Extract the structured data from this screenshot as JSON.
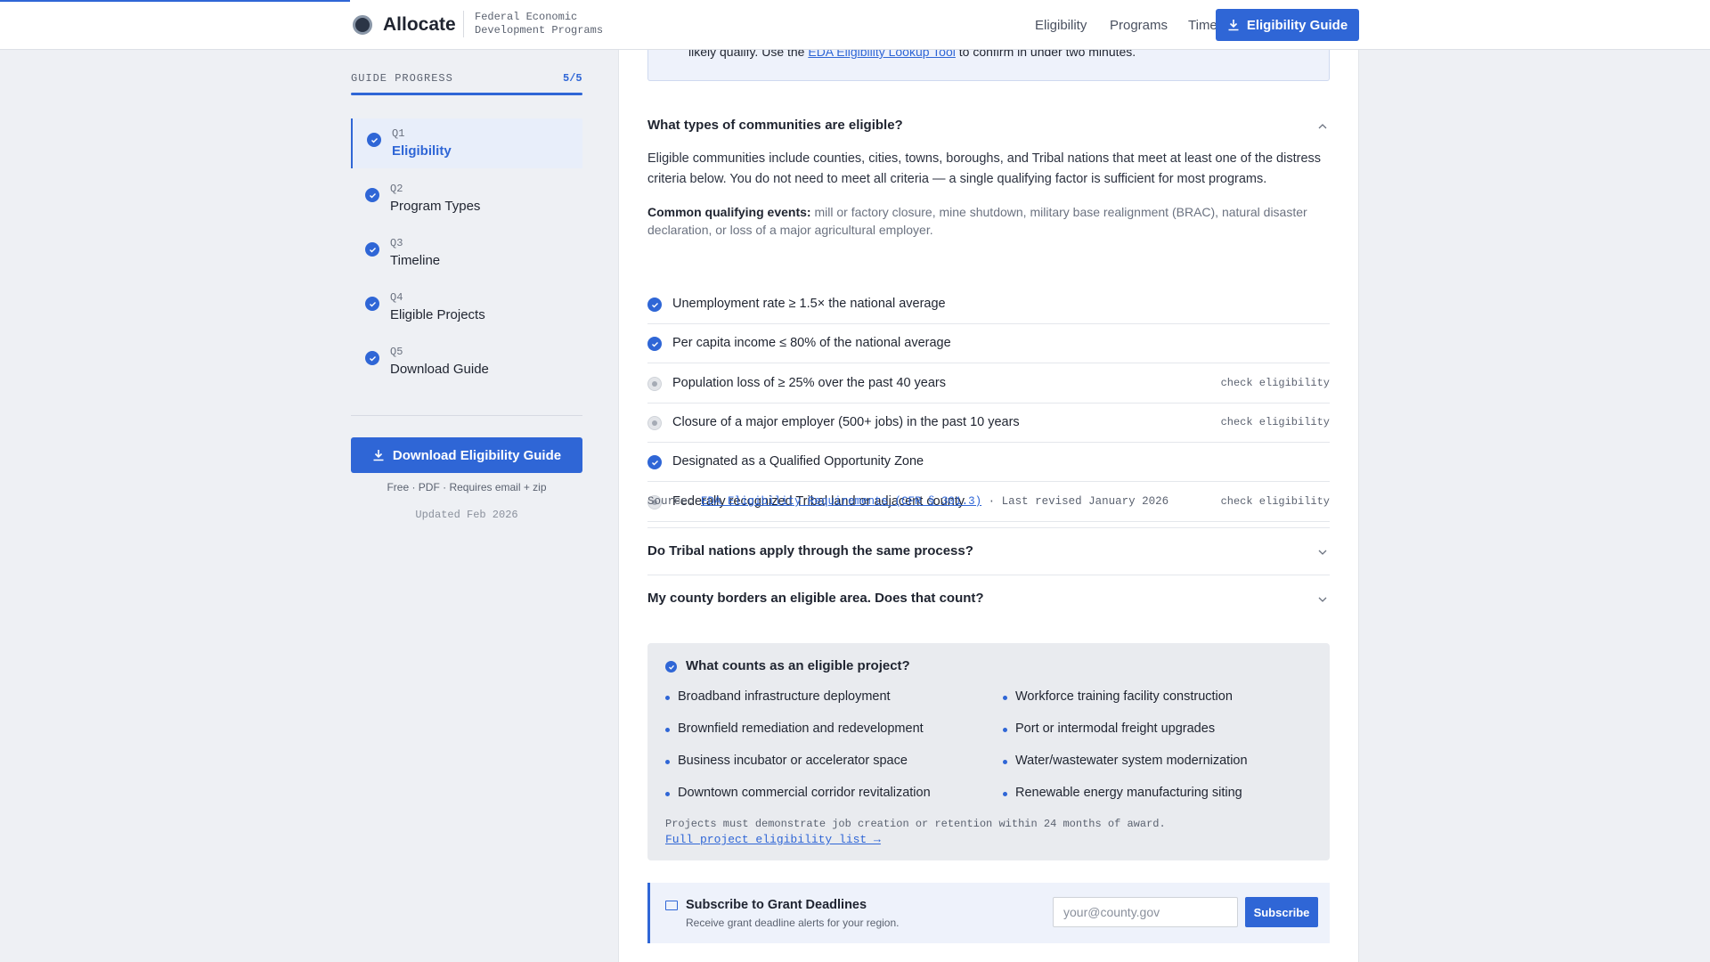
{
  "header": {
    "brand": "Allocate",
    "subtitle": "Federal Economic Development Programs",
    "nav": [
      "Eligibility",
      "Programs",
      "Timeline"
    ],
    "cta_label": "Eligibility Guide"
  },
  "sidebar": {
    "progress_label": "GUIDE PROGRESS",
    "progress_count": "5/5",
    "progress_fraction": 1.0,
    "items": [
      {
        "num": "Q1",
        "title": "Eligibility",
        "active": true
      },
      {
        "num": "Q2",
        "title": "Program Types",
        "active": false
      },
      {
        "num": "Q3",
        "title": "Timeline",
        "active": false
      },
      {
        "num": "Q4",
        "title": "Eligible Projects",
        "active": false
      },
      {
        "num": "Q5",
        "title": "Download Guide",
        "active": false
      }
    ],
    "download_label": "Download Eligibility Guide",
    "download_note": "Free · PDF · Requires email + zip",
    "updated": "Updated Feb 2026"
  },
  "callout": {
    "prefix": "likely qualify. Use the ",
    "link": "EDA Eligibility Lookup Tool",
    "suffix": " to confirm in under two minutes."
  },
  "faq": {
    "q1": "What types of communities are eligible?",
    "answer": "Eligible communities include counties, cities, towns, boroughs, and Tribal nations that meet at least one of the distress criteria below. You do not need to meet all criteria — a single qualifying factor is sufficient for most programs.",
    "events_label": "Common qualifying events:",
    "events_text": " mill or factory closure, mine shutdown, military base realignment (BRAC), natural disaster declaration, or loss of a major agricultural employer.",
    "criteria": [
      {
        "text": "Unemployment rate ≥ 1.5× the national average",
        "met": true,
        "side": ""
      },
      {
        "text": "Per capita income ≤ 80% of the national average",
        "met": true,
        "side": ""
      },
      {
        "text": "Population loss of ≥ 25% over the past 40 years",
        "met": false,
        "side": "check eligibility"
      },
      {
        "text": "Closure of a major employer (500+ jobs) in the past 10 years",
        "met": false,
        "side": "check eligibility"
      },
      {
        "text": "Designated as a Qualified Opportunity Zone",
        "met": true,
        "side": ""
      },
      {
        "text": "Federally recognized Tribal land or adjacent county",
        "met": false,
        "side": "check eligibility"
      }
    ],
    "source_prefix": "Source: ",
    "source_link": "EDA Eligibility Requirements (CFR § 301.3)",
    "source_suffix": " · Last revised January 2026",
    "q2": "Do Tribal nations apply through the same process?",
    "q3": "My county borders an eligible area. Does that count?"
  },
  "projects": {
    "title": "What counts as an eligible project?",
    "left": [
      "Broadband infrastructure deployment",
      "Brownfield remediation and redevelopment",
      "Business incubator or accelerator space",
      "Downtown commercial corridor revitalization"
    ],
    "right": [
      "Workforce training facility construction",
      "Port or intermodal freight upgrades",
      "Water/wastewater system modernization",
      "Renewable energy manufacturing siting"
    ],
    "note": "Projects must demonstrate job creation or retention within 24 months of award.",
    "link": "Full project eligibility list →"
  },
  "subscribe": {
    "title": "Subscribe to Grant Deadlines",
    "desc": "Receive grant deadline alerts for your region.",
    "placeholder": "your@county.gov",
    "button": "Subscribe"
  },
  "colors": {
    "accent": "#2f66d6",
    "background": "#eef0f4"
  }
}
